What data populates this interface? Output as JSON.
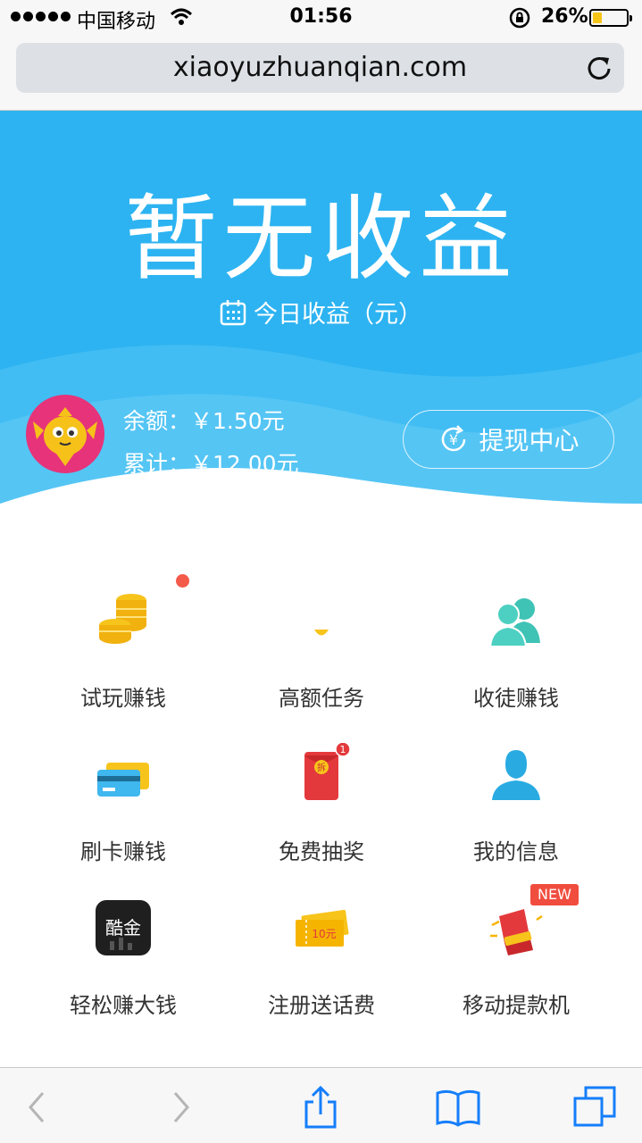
{
  "status_bar": {
    "carrier": "中国移动",
    "time": "01:56",
    "battery_percent": "26%",
    "battery_level": 0.26
  },
  "browser": {
    "url": "xiaoyuzhuanqian.com"
  },
  "hero": {
    "headline": "暂无收益",
    "subtitle": "今日收益（元）",
    "balance": "余额：￥1.50元",
    "total": "累计：￥12.00元",
    "withdraw_button": "提现中心",
    "bg_color": "#2db3f1"
  },
  "menu": [
    {
      "label": "试玩赚钱",
      "icon": "coins-icon"
    },
    {
      "label": "高额任务",
      "icon": "gold-drop-icon"
    },
    {
      "label": "收徒赚钱",
      "icon": "users-icon"
    },
    {
      "label": "刷卡赚钱",
      "icon": "cards-icon"
    },
    {
      "label": "免费抽奖",
      "icon": "red-envelope-icon",
      "badge": "1",
      "icon_text": "拆"
    },
    {
      "label": "我的信息",
      "icon": "user-icon"
    },
    {
      "label": "轻松赚大钱",
      "icon": "kujin-app-icon",
      "icon_text": "酷金"
    },
    {
      "label": "注册送话费",
      "icon": "voucher-icon",
      "icon_text": "10元"
    },
    {
      "label": "移动提款机",
      "icon": "cash-machine-icon",
      "badge": "NEW"
    }
  ],
  "toolbar": {
    "items": [
      "back-icon",
      "forward-icon",
      "share-icon",
      "bookmarks-icon",
      "tabs-icon"
    ]
  }
}
